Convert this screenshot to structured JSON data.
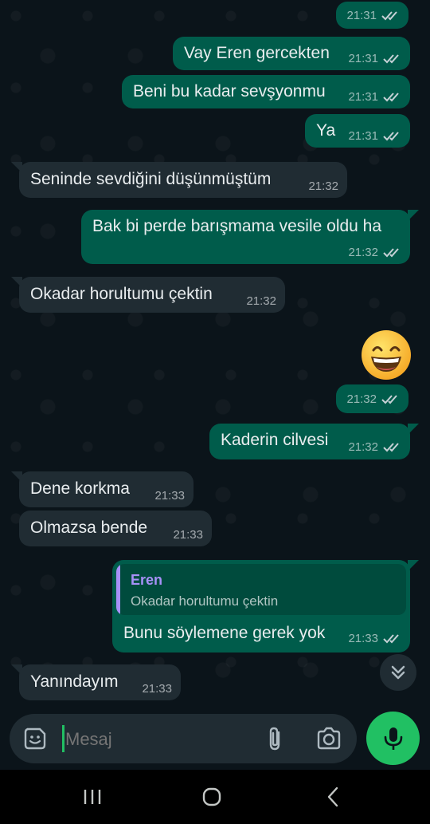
{
  "messages": [
    {
      "id": "m0",
      "dir": "out",
      "text": "",
      "time": "21:31",
      "read": true
    },
    {
      "id": "m1",
      "dir": "out",
      "text": "Vay Eren gercekten",
      "time": "21:31",
      "read": true
    },
    {
      "id": "m2",
      "dir": "out",
      "text": "Beni bu kadar sevşyonmu",
      "time": "21:31",
      "read": true
    },
    {
      "id": "m3",
      "dir": "out",
      "text": "Ya",
      "time": "21:31",
      "read": true
    },
    {
      "id": "m4",
      "dir": "in",
      "text": "Seninde sevdiğini düşünmüştüm",
      "time": "21:32"
    },
    {
      "id": "m5",
      "dir": "out",
      "text": "Bak bi perde barışmama vesile oldu ha",
      "time": "21:32",
      "read": true
    },
    {
      "id": "m6",
      "dir": "in",
      "text": "Okadar horultumu çektin",
      "time": "21:32"
    },
    {
      "id": "m7",
      "dir": "out",
      "emoji": "😄",
      "emoji_name": "grinning-face-with-smiling-eyes",
      "time": "21:32",
      "read": true
    },
    {
      "id": "m8",
      "dir": "out",
      "text": "Kaderin cilvesi",
      "time": "21:32",
      "read": true
    },
    {
      "id": "m9",
      "dir": "in",
      "text": "Dene korkma",
      "time": "21:33"
    },
    {
      "id": "m10",
      "dir": "in",
      "text": "Olmazsa bende",
      "time": "21:33"
    },
    {
      "id": "m11",
      "dir": "out",
      "text": "Bunu söylemene gerek yok",
      "time": "21:33",
      "read": true,
      "reply": {
        "author": "Eren",
        "text": "Okadar horultumu çektin"
      }
    },
    {
      "id": "m12",
      "dir": "in",
      "text": "Yanındayım",
      "time": "21:33"
    }
  ],
  "composer": {
    "placeholder": "Mesaj"
  },
  "colors": {
    "background": "#0b141a",
    "outgoing_bubble": "#005c4b",
    "incoming_bubble": "#202c33",
    "read_ticks": "#c6d1d6",
    "reply_accent": "#a791f8",
    "mic_button": "#21c063"
  },
  "icons": {
    "scroll_down": "chevron-double-down-icon",
    "sticker": "sticker-icon",
    "attach": "paperclip-icon",
    "camera": "camera-icon",
    "mic": "microphone-icon",
    "nav_recents": "recents-icon",
    "nav_home": "home-icon",
    "nav_back": "back-icon"
  }
}
